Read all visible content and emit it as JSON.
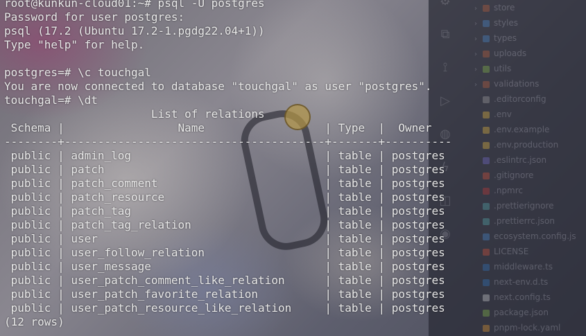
{
  "terminal": {
    "lines": [
      "root@kunkun-cloud01:~# psql -U postgres",
      "Password for user postgres:",
      "psql (17.2 (Ubuntu 17.2-1.pgdg22.04+1))",
      "Type \"help\" for help.",
      "",
      "postgres=# \\c touchgal",
      "You are now connected to database \"touchgal\" as user \"postgres\".",
      "touchgal=# \\dt",
      "                      List of relations",
      " Schema |                 Name                  | Type  |  Owner",
      "--------+---------------------------------------+-------+----------",
      " public | admin_log                             | table | postgres",
      " public | patch                                 | table | postgres",
      " public | patch_comment                         | table | postgres",
      " public | patch_resource                        | table | postgres",
      " public | patch_tag                             | table | postgres",
      " public | patch_tag_relation                    | table | postgres",
      " public | user                                  | table | postgres",
      " public | user_follow_relation                  | table | postgres",
      " public | user_message                          | table | postgres",
      " public | user_patch_comment_like_relation      | table | postgres",
      " public | user_patch_favorite_relation          | table | postgres",
      " public | user_patch_resource_like_relation     | table | postgres",
      "(12 rows)"
    ]
  },
  "explorer": {
    "items": [
      {
        "label": "store",
        "icon": "folder-icon",
        "color": "#c5613c",
        "chevron": true
      },
      {
        "label": "styles",
        "icon": "folder-icon",
        "color": "#4a90d9",
        "chevron": true
      },
      {
        "label": "types",
        "icon": "folder-icon",
        "color": "#4a90d9",
        "chevron": true
      },
      {
        "label": "uploads",
        "icon": "folder-icon",
        "color": "#c5613c",
        "chevron": true
      },
      {
        "label": "utils",
        "icon": "folder-icon",
        "color": "#8bc34a",
        "chevron": true
      },
      {
        "label": "validations",
        "icon": "folder-icon",
        "color": "#c5613c",
        "chevron": true
      },
      {
        "label": ".editorconfig",
        "icon": "gear-icon",
        "color": "#aaaaaa",
        "chevron": false
      },
      {
        "label": ".env",
        "icon": "env-icon",
        "color": "#f0c040",
        "chevron": false
      },
      {
        "label": ".env.example",
        "icon": "env-icon",
        "color": "#f0c040",
        "chevron": false
      },
      {
        "label": ".env.production",
        "icon": "env-icon",
        "color": "#f0c040",
        "chevron": false
      },
      {
        "label": ".eslintrc.json",
        "icon": "eslint-icon",
        "color": "#7b6fd6",
        "chevron": false
      },
      {
        "label": ".gitignore",
        "icon": "git-icon",
        "color": "#e0543a",
        "chevron": false
      },
      {
        "label": ".npmrc",
        "icon": "npm-icon",
        "color": "#cb3837",
        "chevron": false
      },
      {
        "label": ".prettierignore",
        "icon": "prettier-icon",
        "color": "#56b3b4",
        "chevron": false
      },
      {
        "label": ".prettierrc.json",
        "icon": "prettier-icon",
        "color": "#56b3b4",
        "chevron": false
      },
      {
        "label": "ecosystem.config.js",
        "icon": "js-icon",
        "color": "#4a90d9",
        "chevron": false
      },
      {
        "label": "LICENSE",
        "icon": "license-icon",
        "color": "#e0543a",
        "chevron": false
      },
      {
        "label": "middleware.ts",
        "icon": "ts-icon",
        "color": "#3178c6",
        "chevron": false
      },
      {
        "label": "next-env.d.ts",
        "icon": "ts-icon",
        "color": "#3178c6",
        "chevron": false
      },
      {
        "label": "next.config.ts",
        "icon": "next-icon",
        "color": "#dddddd",
        "chevron": false
      },
      {
        "label": "package.json",
        "icon": "json-icon",
        "color": "#8bc34a",
        "chevron": false
      },
      {
        "label": "pnpm-lock.yaml",
        "icon": "yaml-icon",
        "color": "#f0a030",
        "chevron": false
      }
    ]
  },
  "activity": {
    "icons": [
      "extensions-icon",
      "remote-explorer-icon",
      "source-control-icon",
      "run-debug-icon",
      "docker-icon",
      "lightning-icon",
      "database-icon",
      "github-icon"
    ]
  }
}
